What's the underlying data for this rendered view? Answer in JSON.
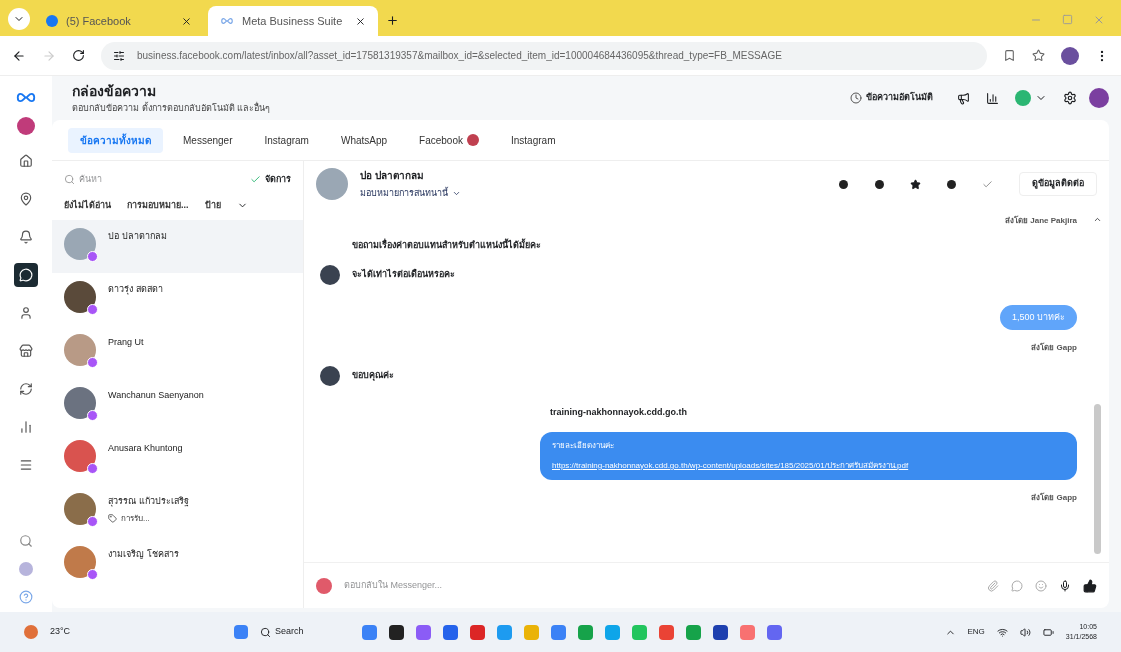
{
  "browser": {
    "tabs": [
      {
        "title": "(5) Facebook",
        "selected": false,
        "kind": "facebook"
      },
      {
        "title": "Meta Business Suite",
        "selected": true,
        "kind": "meta"
      }
    ],
    "url": "business.facebook.com/latest/inbox/all?asset_id=17581319357&mailbox_id=&selected_item_id=100004684436095&thread_type=FB_MESSAGE"
  },
  "header": {
    "title": "กล่องข้อความ",
    "subtitle": "ตอบกลับข้อความ ตั้งการตอบกลับอัตโนมัติ และอื่นๆ",
    "auto_reply": "ข้อความอัตโนมัติ"
  },
  "nav": [
    {
      "kind": "home",
      "selected": false
    },
    {
      "kind": "pin",
      "selected": false
    },
    {
      "kind": "notify",
      "selected": false
    },
    {
      "kind": "inbox",
      "selected": true
    },
    {
      "kind": "person",
      "selected": false
    },
    {
      "kind": "store",
      "selected": false
    },
    {
      "kind": "sync",
      "selected": false
    },
    {
      "kind": "chart",
      "selected": false
    },
    {
      "kind": "menu",
      "selected": false
    }
  ],
  "tabs": [
    {
      "label": "ข้อความทั้งหมด",
      "selected": true,
      "badge": false
    },
    {
      "label": "Messenger",
      "selected": false,
      "badge": false
    },
    {
      "label": "Instagram",
      "selected": false,
      "badge": false
    },
    {
      "label": "WhatsApp",
      "selected": false,
      "badge": false
    },
    {
      "label": "Facebook",
      "selected": false,
      "badge": true
    },
    {
      "label": "Instagram",
      "selected": false,
      "badge": false
    }
  ],
  "list": {
    "search_placeholder": "ค้นหา",
    "manage": "จัดการ",
    "filters": [
      "ยังไม่ได้อ่าน",
      "การมอบหมาย...",
      "ป้าย"
    ],
    "conversations": [
      {
        "name": "ปอ ปลาตากลม",
        "selected": true
      },
      {
        "name": "ดาวรุ่ง สดสดา",
        "selected": false
      },
      {
        "name": "Prang Ut",
        "selected": false
      },
      {
        "name": "Wanchanun Saenyanon",
        "selected": false
      },
      {
        "name": "Anusara Khuntong",
        "selected": false
      },
      {
        "name": "สุวรรณ แก้วประเสริฐ",
        "selected": false,
        "tag": "การรับ..."
      },
      {
        "name": "งามเจริญ โชคสาร",
        "selected": false
      }
    ]
  },
  "chat": {
    "name": "ปอ ปลาตากลม",
    "assign": "มอบหมายการสนทนานี้",
    "contact_button": "ดูข้อมูลติดต่อ",
    "messages": [
      {
        "kind": "meta",
        "text": "ส่งโดย Jane Pakjira"
      },
      {
        "kind": "in",
        "text": "ขอถามเรื่องค่าตอบแทนสำหรับตำแหน่งนี้ได้มั้ยคะ"
      },
      {
        "kind": "in",
        "text": "จะได้เท่าไรต่อเดือนหรอคะ"
      },
      {
        "kind": "out",
        "text": "1,500 บาทค่ะ"
      },
      {
        "kind": "meta",
        "text": "ส่งโดย Gapp"
      },
      {
        "kind": "in",
        "text": "ขอบคุณค่ะ"
      },
      {
        "kind": "link",
        "text": "training-nakhonnayok.cdd.go.th"
      },
      {
        "kind": "bigout",
        "text": "รายละเอียดงานค่ะ",
        "url": "https://training-nakhonnayok.cdd.go.th/wp-content/uploads/sites/185/2025/01/ประกาศรับสมัครงาน.pdf"
      },
      {
        "kind": "meta",
        "text": "ส่งโดย Gapp"
      }
    ],
    "composer_placeholder": "ตอบกลับใน Messenger..."
  },
  "taskbar": {
    "weather": "23°C",
    "search": "Search",
    "lang": "ENG",
    "time": "10:05",
    "date": "31/1/2568"
  }
}
